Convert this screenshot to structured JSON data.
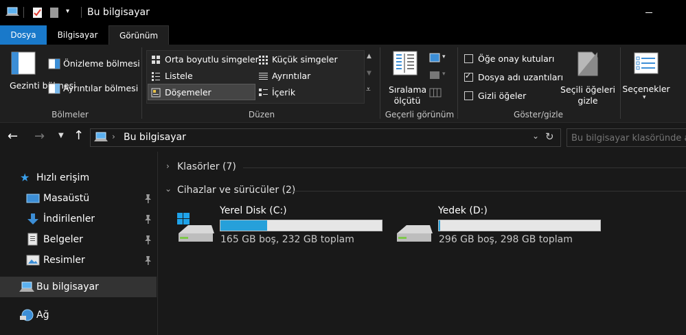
{
  "window": {
    "title": "Bu bilgisayar"
  },
  "tabs": [
    {
      "label": "Dosya"
    },
    {
      "label": "Bilgisayar"
    },
    {
      "label": "Görünüm"
    }
  ],
  "ribbon": {
    "panes": {
      "navigation_pane": "Gezinti bölmesi",
      "preview_pane": "Önizleme bölmesi",
      "details_pane": "Ayrıntılar bölmesi",
      "group_label": "Bölmeler"
    },
    "layout": {
      "options": [
        "Orta boyutlu simgeler",
        "Küçük simgeler",
        "Listele",
        "Ayrıntılar",
        "Döşemeler",
        "İçerik"
      ],
      "selected": "Döşemeler",
      "group_label": "Düzen"
    },
    "current_view": {
      "sort_by": "Sıralama ölçütü",
      "group_label": "Geçerli görünüm"
    },
    "show_hide": {
      "item_checkboxes": {
        "label": "Öğe onay kutuları",
        "checked": false
      },
      "file_extensions": {
        "label": "Dosya adı uzantıları",
        "checked": true
      },
      "hidden_items": {
        "label": "Gizli öğeler",
        "checked": false
      },
      "hide_selected": "Seçili öğeleri gizle",
      "group_label": "Göster/gizle"
    },
    "options": {
      "label": "Seçenekler"
    }
  },
  "address": {
    "path": "Bu bilgisayar",
    "search_placeholder": "Bu bilgisayar klasöründe ara"
  },
  "nav": {
    "quick_access": "Hızlı erişim",
    "items": [
      {
        "label": "Masaüstü"
      },
      {
        "label": "İndirilenler"
      },
      {
        "label": "Belgeler"
      },
      {
        "label": "Resimler"
      }
    ],
    "this_pc": "Bu bilgisayar",
    "network": "Ağ"
  },
  "content": {
    "folders_header": "Klasörler (7)",
    "devices_header": "Cihazlar ve sürücüler (2)",
    "drives": [
      {
        "name": "Yerel Disk (C:)",
        "info": "165 GB boş, 232 GB toplam",
        "used_fraction": 0.289
      },
      {
        "name": "Yedek (D:)",
        "info": "296 GB boş, 298 GB toplam",
        "used_fraction": 0.007
      }
    ]
  },
  "colors": {
    "accent": "#1979ca",
    "bar_fill": "#26a0da",
    "background": "#191919"
  }
}
